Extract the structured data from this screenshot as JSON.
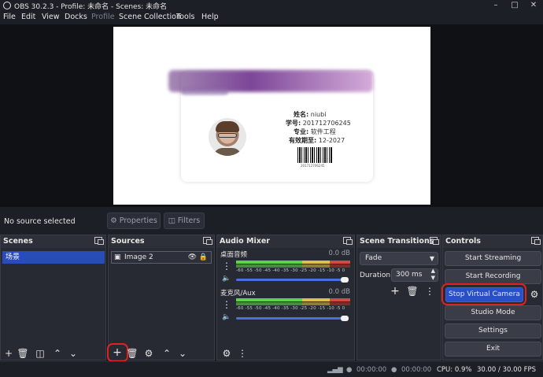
{
  "window": {
    "title": "OBS 30.2.3 - Profile: 未命名 - Scenes: 未命名"
  },
  "menubar": {
    "items": [
      "File",
      "Edit",
      "View",
      "Docks",
      "Profile",
      "Scene Collection",
      "Tools",
      "Help"
    ]
  },
  "preview": {
    "card": {
      "name_label": "姓名:",
      "name": "niubi",
      "id_label": "学号:",
      "id": "201712706245",
      "major_label": "专业:",
      "major": "软件工程",
      "expiry_label": "有效期至:",
      "expiry": "12-2027",
      "barcode_number": "201712706245"
    }
  },
  "source_bar": {
    "status": "No source selected",
    "properties": "Properties",
    "filters": "Filters"
  },
  "scenes": {
    "title": "Scenes",
    "items": [
      "场景"
    ]
  },
  "sources": {
    "title": "Sources",
    "items": [
      {
        "name": "Image 2",
        "visible": true,
        "locked": true
      }
    ]
  },
  "audio_mixer": {
    "title": "Audio Mixer",
    "scale": "-60 -55 -50 -45 -40 -35 -30 -25 -20 -15 -10 -5 0",
    "channels": [
      {
        "name": "桌面音频",
        "db": "0.0 dB",
        "level": 1.0
      },
      {
        "name": "麦克风/Aux",
        "db": "0.0 dB",
        "level": 1.0
      }
    ]
  },
  "scene_transitions": {
    "title": "Scene Transitions",
    "transition": "Fade",
    "duration_label": "Duration",
    "duration": "300 ms"
  },
  "controls": {
    "title": "Controls",
    "start_streaming": "Start Streaming",
    "start_recording": "Start Recording",
    "stop_virtual_camera": "Stop Virtual Camera",
    "studio_mode": "Studio Mode",
    "settings": "Settings",
    "exit": "Exit"
  },
  "status_bar": {
    "stream_time": "00:00:00",
    "record_time": "00:00:00",
    "cpu": "CPU: 0.9%",
    "fps": "30.00 / 30.00 FPS"
  },
  "colors": {
    "accent": "#284cb8",
    "highlight_ring": "#e0221f",
    "active_button": "#2a50c8"
  }
}
